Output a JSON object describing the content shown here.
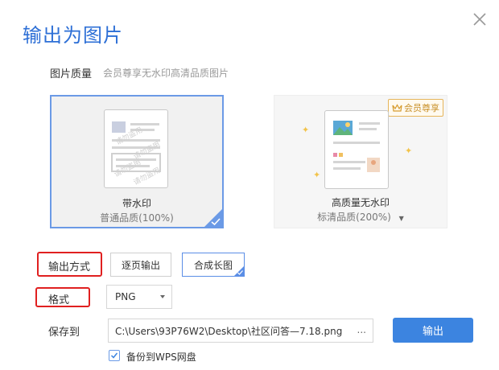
{
  "dialog": {
    "title": "输出为图片"
  },
  "quality": {
    "label": "图片质量",
    "hint": "会员尊享无水印高清品质图片",
    "options": [
      {
        "name": "带水印",
        "sub": "普通品质(100%)",
        "selected": true
      },
      {
        "name": "高质量无水印",
        "sub": "标清品质(200%)",
        "badge": "会员尊享",
        "selected": false
      }
    ],
    "watermark_text": "请勿盗用"
  },
  "output_mode": {
    "label": "输出方式",
    "buttons": [
      {
        "label": "逐页输出",
        "selected": false
      },
      {
        "label": "合成长图",
        "selected": true
      }
    ]
  },
  "format": {
    "label": "格式",
    "value": "PNG"
  },
  "save": {
    "label": "保存到",
    "path": "C:\\Users\\93P76W2\\Desktop\\社区问答—7.18.png",
    "browse": "...",
    "submit": "输出"
  },
  "backup": {
    "label": "备份到WPS网盘",
    "checked": true
  },
  "colors": {
    "accent": "#3c84e0",
    "highlight_box": "#e02020",
    "vip": "#c89028"
  }
}
